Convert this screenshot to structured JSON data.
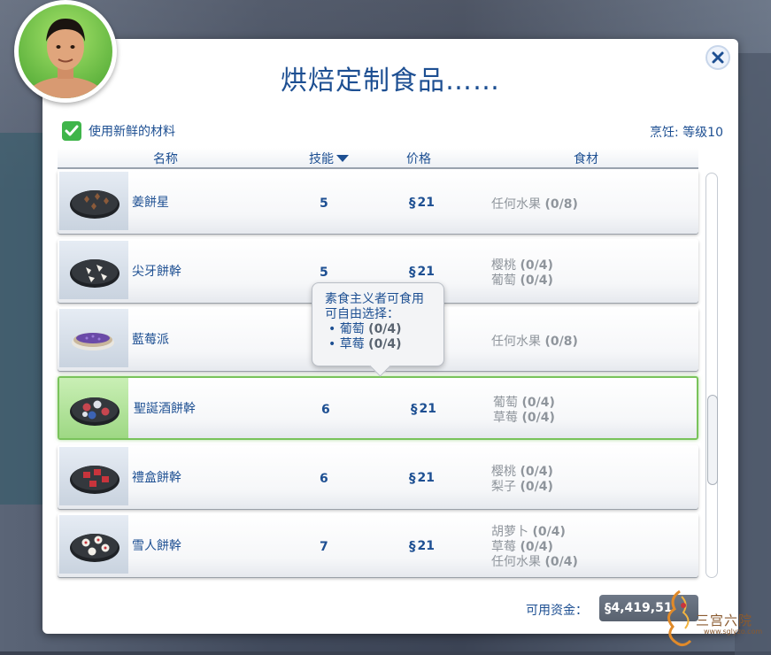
{
  "dialog": {
    "title": "烘焙定制食品……",
    "fresh_label": "使用新鲜的材料",
    "fresh_checked": true,
    "skill_label": "烹饪: 等级10"
  },
  "header": {
    "name": "名称",
    "skill": "技能",
    "price": "价格",
    "ingredients": "食材"
  },
  "currency_symbol": "§",
  "recipes": [
    {
      "name": "姜餅星",
      "skill": "5",
      "price": "21",
      "ingredients": [
        {
          "item": "任何水果",
          "qty": "(0/8)"
        }
      ]
    },
    {
      "name": "尖牙餅幹",
      "skill": "5",
      "price": "21",
      "ingredients": [
        {
          "item": "樱桃",
          "qty": "(0/4)"
        },
        {
          "item": "葡萄",
          "qty": "(0/4)"
        }
      ]
    },
    {
      "name": "藍莓派",
      "skill": "",
      "price": "",
      "ingredients": [
        {
          "item": "任何水果",
          "qty": "(0/8)"
        }
      ]
    },
    {
      "name": "聖誕酒餅幹",
      "skill": "6",
      "price": "21",
      "ingredients": [
        {
          "item": "葡萄",
          "qty": "(0/4)"
        },
        {
          "item": "草莓",
          "qty": "(0/4)"
        }
      ]
    },
    {
      "name": "禮盒餅幹",
      "skill": "6",
      "price": "21",
      "ingredients": [
        {
          "item": "樱桃",
          "qty": "(0/4)"
        },
        {
          "item": "梨子",
          "qty": "(0/4)"
        }
      ]
    },
    {
      "name": "雪人餅幹",
      "skill": "7",
      "price": "21",
      "ingredients": [
        {
          "item": "胡萝卜",
          "qty": "(0/4)"
        },
        {
          "item": "草莓",
          "qty": "(0/4)"
        },
        {
          "item": "任何水果",
          "qty": "(0/4)"
        }
      ]
    }
  ],
  "tooltip": {
    "line1": "素食主义者可食用",
    "line2": "可自由选择：",
    "options": [
      {
        "item": "• 葡萄",
        "qty": "(0/4)"
      },
      {
        "item": "• 草莓",
        "qty": "(0/4)"
      }
    ]
  },
  "funds": {
    "label": "可用资金：",
    "value": "4,419,51"
  },
  "watermark": {
    "text": "三宫六院",
    "url": "www.sglyzo.com"
  },
  "colors": {
    "accent": "#1d4f92",
    "selected": "#79c35b",
    "check": "#3fb54a"
  },
  "icons": {
    "close": "close-icon",
    "sort": "sort-desc-icon",
    "check": "checkmark-icon",
    "currency": "simoleon-icon"
  }
}
